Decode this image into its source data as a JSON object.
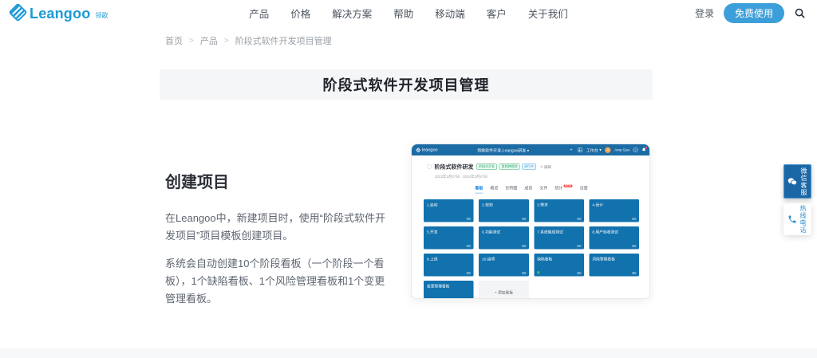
{
  "colors": {
    "brand": "#1c9ad6",
    "cta": "#3d9fd9",
    "topbar": "#1b6ba5",
    "card": "#1272ae",
    "tab_active": "#1e88e5",
    "badge_green": "#27a567",
    "badge_blue": "#3d9fd9"
  },
  "brand": {
    "name": "Leangoo",
    "subtitle": "领歌"
  },
  "nav": {
    "items": [
      "产品",
      "价格",
      "解决方案",
      "帮助",
      "移动端",
      "客户",
      "关于我们"
    ],
    "login": "登录",
    "cta": "免费使用"
  },
  "breadcrumb": {
    "items": [
      "首页",
      "产品",
      "阶段式软件开发项目管理"
    ],
    "separator": ">"
  },
  "hero": {
    "title": "阶段式软件开发项目管理"
  },
  "section": {
    "heading": "创建项目",
    "paragraphs": [
      "在Leangoo中，新建项目时，使用“阶段式软件开发项目”项目模板创建项目。",
      "系统会自动创建10个阶段看板（一个阶段一个看板），1个缺陷看板、1个风险管理看板和1个变更管理看板。"
    ]
  },
  "app": {
    "topbar": {
      "logo": "leangoo",
      "center": "领歌软件开发-Leangoo研发",
      "caret": "▾",
      "plus": "+",
      "menu": "工作台",
      "user": "Amy Guo",
      "help": "?"
    },
    "project": {
      "name": "阶段式软件研发",
      "badges": [
        {
          "label": "阶段式开发",
          "tone": "green"
        },
        {
          "label": "里程碑规划",
          "tone": "green"
        },
        {
          "label": "进行中",
          "tone": "blue"
        }
      ],
      "edit": "✎ 编辑",
      "dates": "2023年3月27日 - 2024年3月27日"
    },
    "tabs": [
      {
        "label": "看板",
        "active": true
      },
      {
        "label": "概览"
      },
      {
        "label": "甘特图"
      },
      {
        "label": "成员"
      },
      {
        "label": "文件"
      },
      {
        "label": "统计",
        "badge": "NEW"
      },
      {
        "label": "设置"
      }
    ],
    "boards": [
      {
        "label": "1.启动"
      },
      {
        "label": "2.规划"
      },
      {
        "label": "3.需求"
      },
      {
        "label": "4.设计"
      },
      {
        "label": "5.开发"
      },
      {
        "label": "6.功能测试"
      },
      {
        "label": "7.系统集成测试"
      },
      {
        "label": "8.用户验收测试"
      },
      {
        "label": "9.上线"
      },
      {
        "label": "10.结项"
      },
      {
        "label": "缺陷看板",
        "dot": true
      },
      {
        "label": "风险管理看板"
      },
      {
        "label": "变更管理看板"
      }
    ],
    "add_board": "+ 添加看板"
  },
  "floating": {
    "wechat": "微信客服",
    "phone": "热线电话"
  }
}
